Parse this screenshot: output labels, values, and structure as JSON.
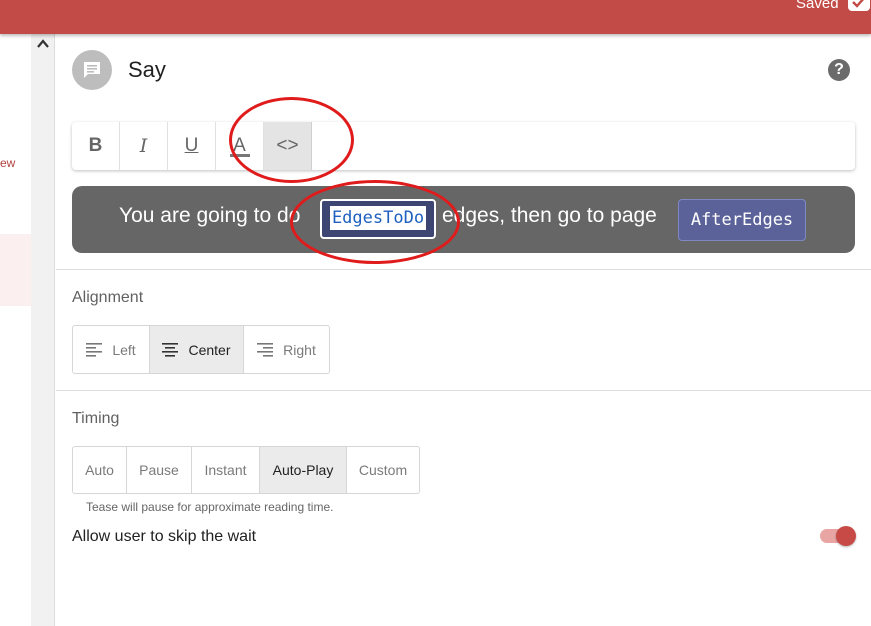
{
  "header": {
    "saved_label": "Saved"
  },
  "left_panel": {
    "fragment_text": "ew"
  },
  "editor": {
    "title": "Say",
    "toolbar": {
      "bold_label": "B",
      "italic_label": "I",
      "underline_label": "U",
      "color_label": "A",
      "code_label": "<>"
    },
    "preview": {
      "text_before": "You are going to do",
      "variable_1": "EdgesToDo",
      "text_middle": "edges, then go to page",
      "variable_2": "AfterEdges"
    }
  },
  "alignment": {
    "label": "Alignment",
    "options": [
      "Left",
      "Center",
      "Right"
    ],
    "selected": "Center"
  },
  "timing": {
    "label": "Timing",
    "options": [
      "Auto",
      "Pause",
      "Instant",
      "Auto-Play",
      "Custom"
    ],
    "selected": "Auto-Play",
    "hint": "Tease will pause for approximate reading time."
  },
  "skip_wait": {
    "label": "Allow user to skip the wait",
    "enabled": true
  },
  "colors": {
    "topbar": "#c24b47",
    "preview_bg": "#666666",
    "variable_chip": "#5a6299",
    "annotation": "#e01b1b",
    "toggle_on": "#c84a46"
  },
  "icons": {
    "avatar": "chat-bubble-icon",
    "help": "help-circle-icon",
    "scroll_up": "chevron-up-icon",
    "saved": "check-icon"
  }
}
